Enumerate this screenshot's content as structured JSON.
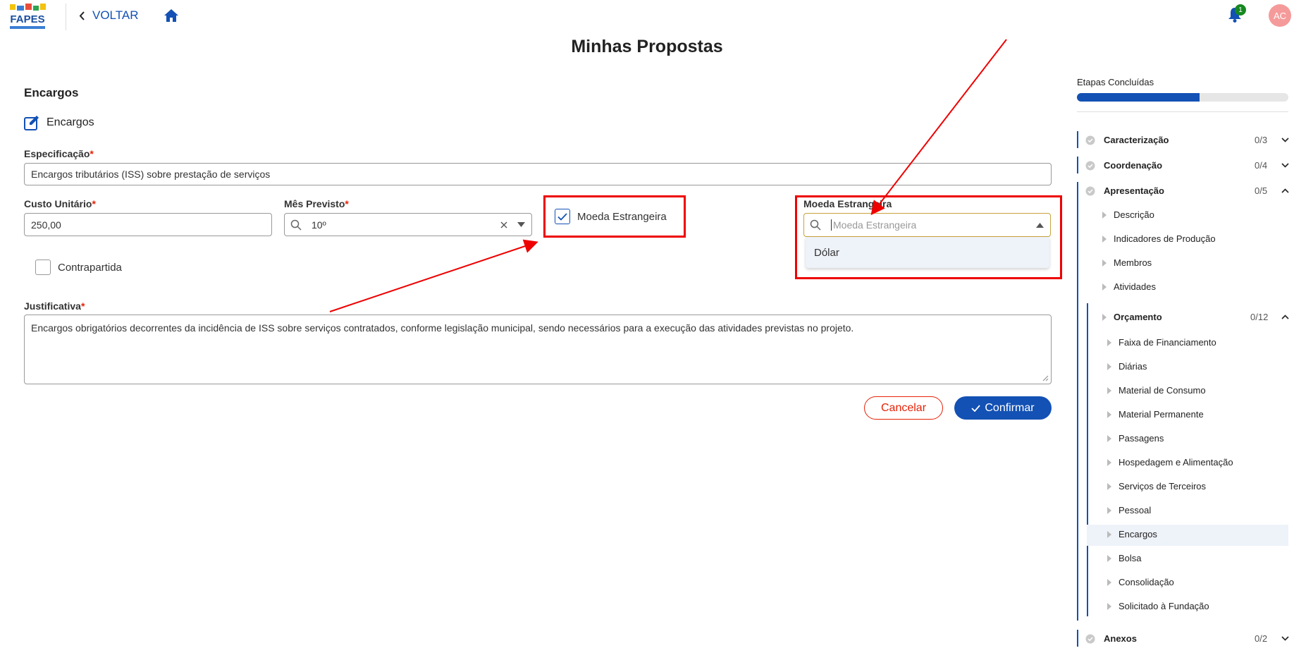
{
  "header": {
    "back_label": "VOLTAR",
    "notification_count": "1",
    "avatar_initials": "AC"
  },
  "page_title": "Minhas Propostas",
  "form": {
    "section_title": "Encargos",
    "subsection_title": "Encargos",
    "especificacao": {
      "label": "Especificação",
      "required": "*",
      "value": "Encargos tributários (ISS) sobre prestação de serviços"
    },
    "custo_unitario": {
      "label": "Custo Unitário",
      "required": "*",
      "value": "250,00"
    },
    "mes_previsto": {
      "label": "Mês Previsto",
      "required": "*",
      "value": "10º"
    },
    "moeda_estrangeira_checkbox": {
      "label": "Moeda Estrangeira",
      "checked": true
    },
    "moeda_estrangeira_select": {
      "label": "Moeda Estrangeira",
      "placeholder": "Moeda Estrangeira",
      "options": [
        "Dólar"
      ]
    },
    "contrapartida": {
      "label": "Contrapartida",
      "checked": false
    },
    "justificativa": {
      "label": "Justificativa",
      "required": "*",
      "value": "Encargos obrigatórios decorrentes da incidência de ISS sobre serviços contratados, conforme legislação municipal, sendo necessários para a execução das atividades previstas no projeto."
    },
    "cancel_label": "Cancelar",
    "confirm_label": "Confirmar"
  },
  "sidebar": {
    "etapas_label": "Etapas Concluídas",
    "progress_fraction": 0.58,
    "sections": [
      {
        "label": "Caracterização",
        "count": "0/3",
        "expanded": false
      },
      {
        "label": "Coordenação",
        "count": "0/4",
        "expanded": false
      },
      {
        "label": "Apresentação",
        "count": "0/5",
        "expanded": true
      },
      {
        "label": "Anexos",
        "count": "0/2",
        "expanded": false
      }
    ],
    "apresentacao_items": [
      "Descrição",
      "Indicadores de Produção",
      "Membros",
      "Atividades"
    ],
    "orcamento": {
      "label": "Orçamento",
      "count": "0/12"
    },
    "orcamento_items": [
      "Faixa de Financiamento",
      "Diárias",
      "Material de Consumo",
      "Material Permanente",
      "Passagens",
      "Hospedagem e Alimentação",
      "Serviços de Terceiros",
      "Pessoal",
      "Encargos",
      "Bolsa",
      "Consolidação",
      "Solicitado à Fundação"
    ],
    "active_item": "Encargos"
  }
}
